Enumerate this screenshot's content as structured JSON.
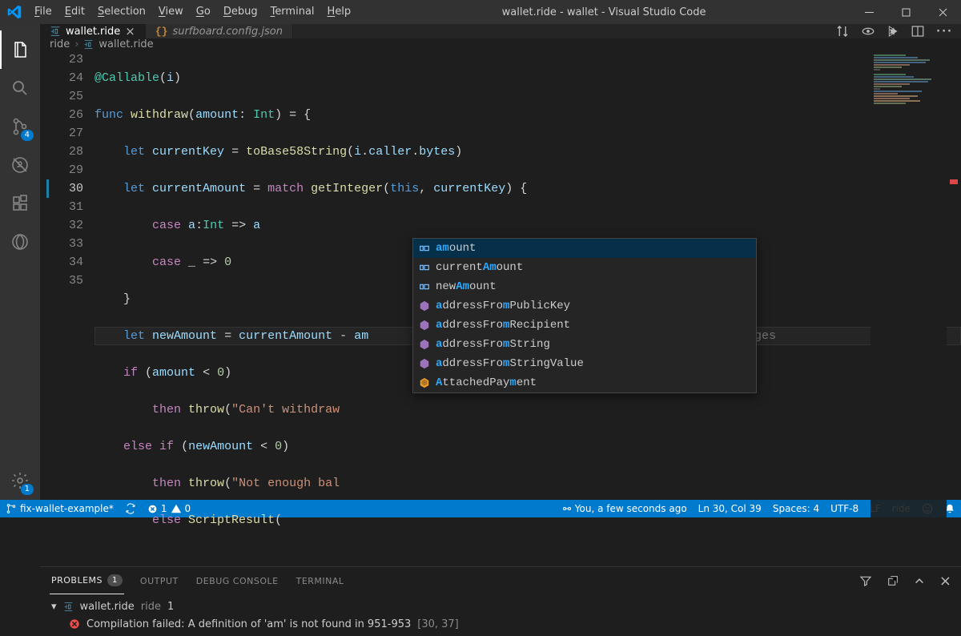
{
  "window": {
    "title": "wallet.ride - wallet - Visual Studio Code"
  },
  "menu": [
    "File",
    "Edit",
    "Selection",
    "View",
    "Go",
    "Debug",
    "Terminal",
    "Help"
  ],
  "activity": {
    "scm_badge": "4",
    "settings_badge": "1"
  },
  "tabs": [
    {
      "name": "wallet.ride",
      "active": true
    },
    {
      "name": "surfboard.config.json",
      "active": false
    }
  ],
  "breadcrumb": {
    "folder": "ride",
    "file": "wallet.ride"
  },
  "editor": {
    "line_start": 23,
    "lines": [
      "@Callable(i)",
      "func withdraw(amount: Int) = {",
      "    let currentKey = toBase58String(i.caller.bytes)",
      "    let currentAmount = match getInteger(this, currentKey) {",
      "        case a:Int => a",
      "        case _ => 0",
      "    }",
      "    let newAmount = currentAmount - am",
      "    if (amount < 0)",
      "        then throw(\"Can't withdraw ",
      "    else if (newAmount < 0)",
      "        then throw(\"Not enough bal",
      "        else ScriptResult("
    ],
    "current_line": 30,
    "codelens": "You, a few seconds ago • Uncommitted changes"
  },
  "suggest": [
    {
      "kind": "var",
      "label": "amount",
      "match": "am"
    },
    {
      "kind": "var",
      "label": "currentAmount",
      "match": "Am"
    },
    {
      "kind": "var",
      "label": "newAmount",
      "match": "Am"
    },
    {
      "kind": "fn",
      "label": "addressFromPublicKey",
      "match": "m"
    },
    {
      "kind": "fn",
      "label": "addressFromRecipient",
      "match": "m"
    },
    {
      "kind": "fn",
      "label": "addressFromString",
      "match": "m"
    },
    {
      "kind": "fn",
      "label": "addressFromStringValue",
      "match": "m"
    },
    {
      "kind": "cls",
      "label": "AttachedPayment",
      "match": "A m"
    }
  ],
  "panel": {
    "tabs": [
      "PROBLEMS",
      "OUTPUT",
      "DEBUG CONSOLE",
      "TERMINAL"
    ],
    "problem_count": "1",
    "file": "wallet.ride",
    "file_lang": "ride",
    "file_count": "1",
    "error": "Compilation failed: A definition of 'am' is not found in 951-953",
    "error_loc": "[30, 37]"
  },
  "status": {
    "branch": "fix-wallet-example*",
    "errors": "1",
    "warnings": "0",
    "git_blame": "You, a few seconds ago",
    "cursor": "Ln 30, Col 39",
    "spaces": "Spaces: 4",
    "encoding": "UTF-8",
    "eol": "LF",
    "lang": "ride"
  }
}
